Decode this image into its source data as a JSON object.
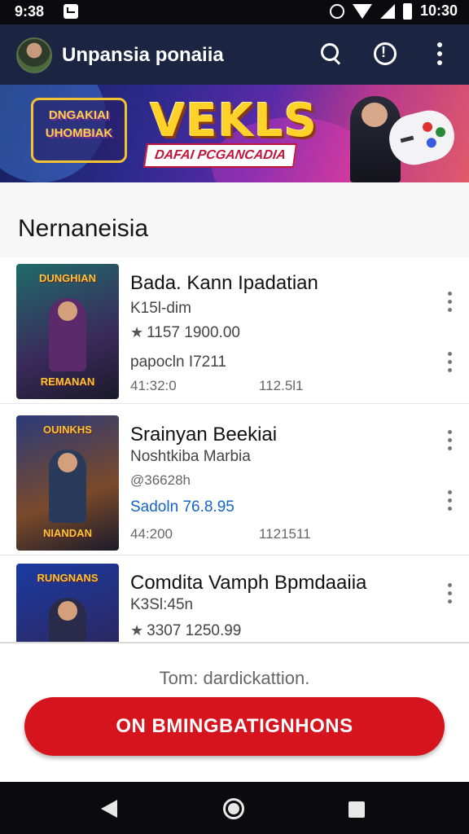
{
  "status_bar": {
    "time_left": "9:38",
    "time_right": "10:30"
  },
  "app_bar": {
    "title": "Unpansia ponaiia"
  },
  "banner": {
    "badge_line1": "DNGAKIAI",
    "badge_line2": "UHOMBIAK",
    "headline": "VEKLS",
    "subline": "DAFAI PCGANCADIA"
  },
  "section": {
    "title": "Nernaneisia"
  },
  "items": [
    {
      "thumb_top": "DUNGHIAN",
      "thumb_bottom": "REMANAN",
      "title": "Bada. Kann Ipadatian",
      "subtitle": "K15l-dim",
      "rating": "1157 1900.00",
      "detail": "papocln I7211",
      "meta_left": "41:32:0",
      "meta_right": "112.5l1"
    },
    {
      "thumb_top": "OUINKHS",
      "thumb_bottom": "NIANDAN",
      "title": "Srainyan Beekiai",
      "subtitle": "Noshtkiba Marbia",
      "code": "@36628h",
      "price": "Sadoln 76.8.95",
      "meta_left": "44:200",
      "meta_right": "1121511"
    },
    {
      "thumb_top": "RUNGNANS",
      "thumb_bottom": "",
      "title": "Comdita Vamph Bpmdaaiia",
      "subtitle": "K3Sl:45n",
      "rating": "3307 1250.99"
    }
  ],
  "footer": {
    "text": "Tom: dardickattion.",
    "cta_label": "ON BMINGBATIGNHONS"
  },
  "colors": {
    "app_bar": "#1b2440",
    "cta": "#d5141d",
    "price_text": "#1565c0"
  }
}
